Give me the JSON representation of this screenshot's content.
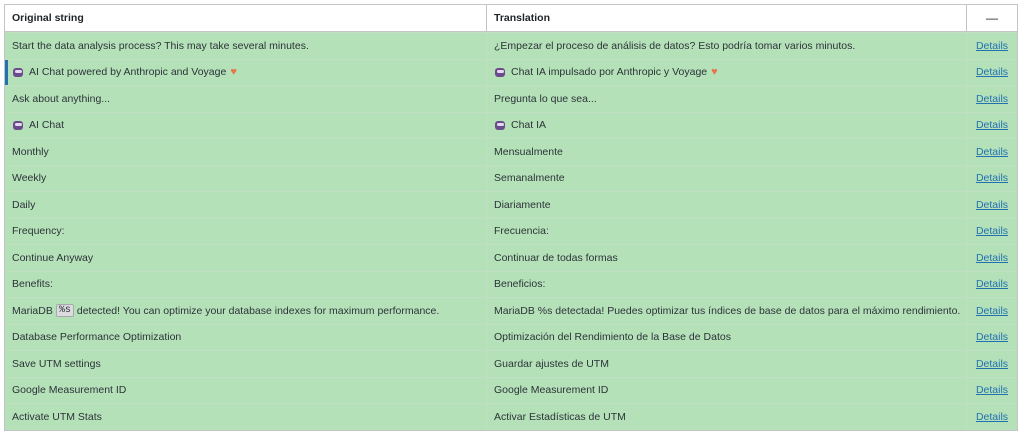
{
  "header": {
    "original_label": "Original string",
    "translation_label": "Translation",
    "actions_label": "—"
  },
  "details_label": "Details",
  "rows": [
    {
      "original_pre": "",
      "original_code": "",
      "original_post": "Start the data analysis process? This may take several minutes.",
      "translation": "¿Empezar el proceso de análisis de datos? Esto podría tomar varios minutos.",
      "icon": false,
      "heart": false
    },
    {
      "original_pre": "",
      "original_code": "",
      "original_post": "AI Chat powered by Anthropic and Voyage",
      "translation": "Chat IA impulsado por Anthropic y Voyage",
      "icon": true,
      "heart": true
    },
    {
      "original_pre": "",
      "original_code": "",
      "original_post": "Ask about anything...",
      "translation": "Pregunta lo que sea...",
      "icon": false,
      "heart": false
    },
    {
      "original_pre": "",
      "original_code": "",
      "original_post": "AI Chat",
      "translation": "Chat IA",
      "icon": true,
      "heart": false
    },
    {
      "original_pre": "",
      "original_code": "",
      "original_post": "Monthly",
      "translation": "Mensualmente",
      "icon": false,
      "heart": false
    },
    {
      "original_pre": "",
      "original_code": "",
      "original_post": "Weekly",
      "translation": "Semanalmente",
      "icon": false,
      "heart": false
    },
    {
      "original_pre": "",
      "original_code": "",
      "original_post": "Daily",
      "translation": "Diariamente",
      "icon": false,
      "heart": false
    },
    {
      "original_pre": "",
      "original_code": "",
      "original_post": "Frequency:",
      "translation": "Frecuencia:",
      "icon": false,
      "heart": false
    },
    {
      "original_pre": "",
      "original_code": "",
      "original_post": "Continue Anyway",
      "translation": "Continuar de todas formas",
      "icon": false,
      "heart": false
    },
    {
      "original_pre": "",
      "original_code": "",
      "original_post": "Benefits:",
      "translation": "Beneficios:",
      "icon": false,
      "heart": false
    },
    {
      "original_pre": "MariaDB",
      "original_code": "%s",
      "original_post": "detected! You can optimize your database indexes for maximum performance.",
      "translation": "MariaDB %s detectada! Puedes optimizar tus índices de base de datos para el máximo rendimiento.",
      "icon": false,
      "heart": false
    },
    {
      "original_pre": "",
      "original_code": "",
      "original_post": "Database Performance Optimization",
      "translation": "Optimización del Rendimiento de la Base de Datos",
      "icon": false,
      "heart": false
    },
    {
      "original_pre": "",
      "original_code": "",
      "original_post": "Save UTM settings",
      "translation": "Guardar ajustes de UTM",
      "icon": false,
      "heart": false
    },
    {
      "original_pre": "",
      "original_code": "",
      "original_post": "Google Measurement ID",
      "translation": "Google Measurement ID",
      "icon": false,
      "heart": false
    },
    {
      "original_pre": "",
      "original_code": "",
      "original_post": "Activate UTM Stats",
      "translation": "Activar Estadísticas de UTM",
      "icon": false,
      "heart": false
    }
  ],
  "colors": {
    "row_background": "#b5e1b9",
    "link": "#2271b1",
    "heart": "#e8744f",
    "robot": "#6a4c8c"
  },
  "icons": {
    "robot": "robot-icon",
    "heart": "heart-icon"
  },
  "active_row_index": 1
}
